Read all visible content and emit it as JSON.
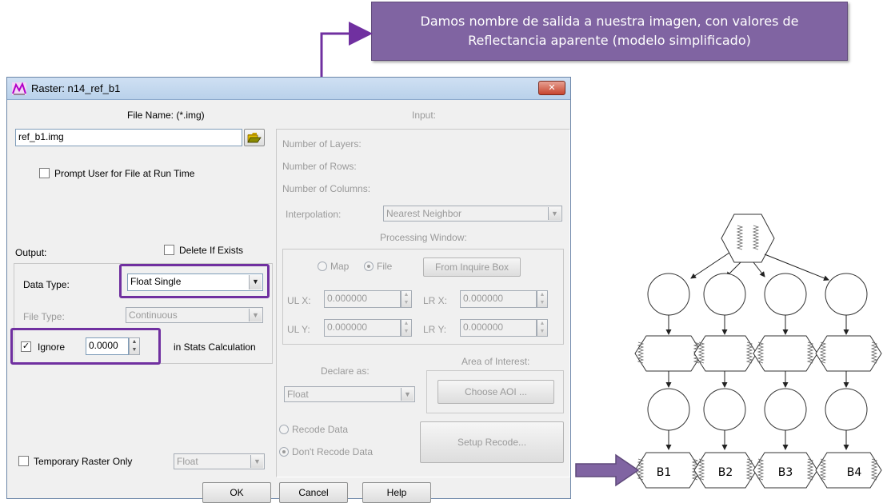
{
  "callout": {
    "line1": "Damos nombre de salida a nuestra imagen, con valores de",
    "line2": "Reflectancia aparente (modelo simplificado)"
  },
  "window": {
    "title": "Raster:  n14_ref_b1",
    "close_glyph": "✕"
  },
  "left": {
    "file_name_label": "File Name: (*.img)",
    "file_value": "ref_b1.img",
    "prompt_label": "Prompt User for File at Run Time",
    "output_label": "Output:",
    "delete_label": "Delete If Exists",
    "data_type_label": "Data Type:",
    "data_type_value": "Float Single",
    "file_type_label": "File Type:",
    "file_type_value": "Continuous",
    "ignore_label": "Ignore",
    "ignore_checked": "✓",
    "ignore_value": "0.0000",
    "stats_label": "in Stats Calculation",
    "temp_label": "Temporary Raster Only",
    "temp_value": "Float"
  },
  "input": {
    "header": "Input:",
    "layers": "Number of Layers:",
    "rows": "Number of Rows:",
    "cols": "Number of Columns:",
    "interp_label": "Interpolation:",
    "interp_value": "Nearest Neighbor",
    "proc_window": "Processing Window:",
    "map_label": "Map",
    "file_label": "File",
    "inquire_btn": "From Inquire Box",
    "ulx_label": "UL X:",
    "ulx_value": "0.000000",
    "lrx_label": "LR X:",
    "lrx_value": "0.000000",
    "uly_label": "UL Y:",
    "uly_value": "0.000000",
    "lry_label": "LR Y:",
    "lry_value": "0.000000",
    "declare_label": "Declare as:",
    "declare_value": "Float",
    "aoi_label": "Area of Interest:",
    "aoi_btn": "Choose AOI ...",
    "recode_label": "Recode Data",
    "no_recode_label": "Don't Recode Data",
    "setup_btn": "Setup Recode..."
  },
  "buttons": {
    "ok": "OK",
    "cancel": "Cancel",
    "help": "Help"
  },
  "diagram": {
    "bands": [
      "B1",
      "B2",
      "B3",
      "B4"
    ],
    "accent": "#7030a0"
  }
}
